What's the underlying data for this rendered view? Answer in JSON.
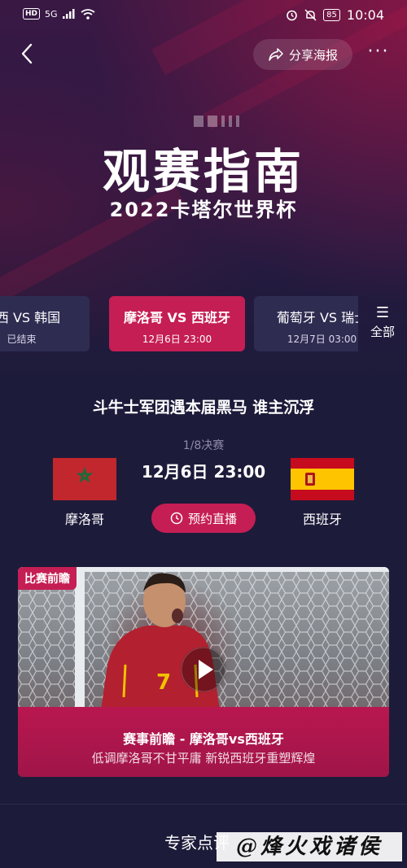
{
  "status_bar": {
    "network_badge": "HD",
    "signal_label": "5G",
    "battery": "85",
    "time": "10:04"
  },
  "nav": {
    "share_label": "分享海报",
    "more_label": "···"
  },
  "hero": {
    "title": "观赛指南",
    "subtitle": "2022卡塔尔世界杯"
  },
  "tabs": [
    {
      "teams": "巴西 VS 韩国",
      "sub": "已结束"
    },
    {
      "teams": "摩洛哥 VS 西班牙",
      "sub": "12月6日 23:00"
    },
    {
      "teams": "葡萄牙 VS 瑞士",
      "sub": "12月7日 03:00"
    }
  ],
  "all_tab": {
    "label": "全部"
  },
  "match": {
    "headline": "斗牛士军团遇本届黑马 谁主沉浮",
    "round": "1/8决赛",
    "datetime": "12月6日 23:00",
    "home_team": "摩洛哥",
    "away_team": "西班牙",
    "live_button": "预约直播"
  },
  "video_card": {
    "tag": "比赛前瞻",
    "title": "赛事前瞻 - 摩洛哥vs西班牙",
    "description": "低调摩洛哥不甘平庸 新锐西班牙重塑辉煌",
    "jersey_number": "7"
  },
  "section": {
    "expert_title": "专家点评"
  },
  "watermark": {
    "text": "@烽火戏诸侯"
  },
  "colors": {
    "accent": "#c51e54",
    "background": "#1d1b3a",
    "tab_bg": "#2f2c52"
  }
}
